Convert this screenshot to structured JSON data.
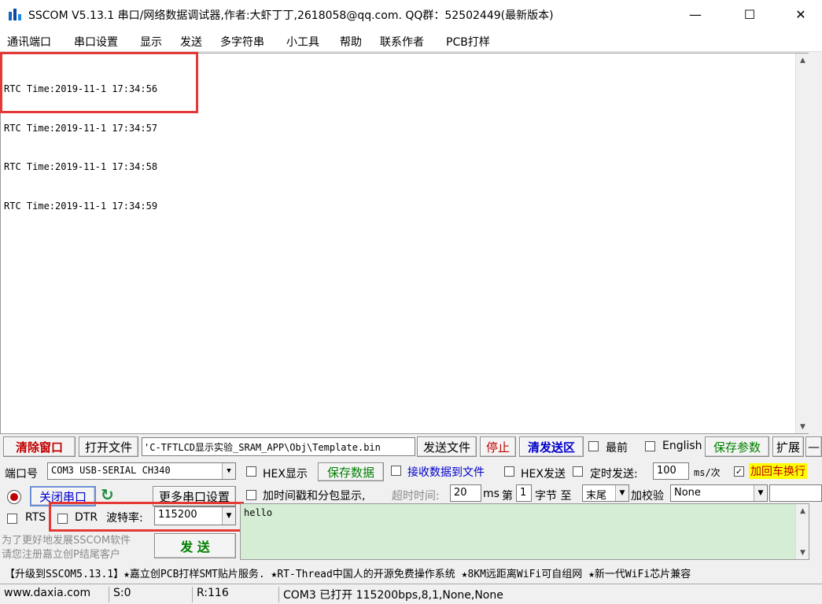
{
  "window": {
    "title": "SSCOM V5.13.1 串口/网络数据调试器,作者:大虾丁丁,2618058@qq.com. QQ群：52502449(最新版本)",
    "minimize": "—",
    "maximize": "☐",
    "close": "✕"
  },
  "menu": [
    "通讯端口",
    "串口设置",
    "显示",
    "发送",
    "多字符串",
    "小工具",
    "帮助",
    "联系作者",
    "PCB打样"
  ],
  "receive": {
    "lines": [
      "RTC Time:2019-11-1 17:34:56",
      "RTC Time:2019-11-1 17:34:57",
      "RTC Time:2019-11-1 17:34:58",
      "RTC Time:2019-11-1 17:34:59"
    ]
  },
  "toolbar": {
    "clear": "清除窗口",
    "open_file": "打开文件",
    "file_path": "'C-TFTLCD显示实验_SRAM_APP\\Obj\\Template.bin",
    "send_file": "发送文件",
    "stop": "停止",
    "clear_send": "清发送区",
    "last": "最前",
    "english": "English",
    "save_params": "保存参数",
    "expand": "扩展",
    "dash": "—"
  },
  "port": {
    "label": "端口号",
    "value": "COM3 USB-SERIAL CH340",
    "close_port": "关闭串口",
    "more_settings": "更多串口设置",
    "rts": "RTS",
    "dtr": "DTR",
    "baud_label": "波特率:",
    "baud_value": "115200"
  },
  "options": {
    "hex_display": "HEX显示",
    "save_data": "保存数据",
    "recv_to_file": "接收数据到文件",
    "hex_send": "HEX发送",
    "timed_send": "定时发送:",
    "interval": "100",
    "interval_unit": "ms/次",
    "add_crlf": "加回车换行",
    "timestamp": "加时间戳和分包显示,",
    "timeout_label": "超时时间:",
    "timeout_value": "20",
    "ms": "ms",
    "nth": "第",
    "byte_index": "1",
    "byte_label": "字节 至",
    "end_value": "末尾",
    "checksum_label": "加校验",
    "checksum_value": "None"
  },
  "promo": {
    "line1": "为了更好地发展SSCOM软件",
    "line2": "请您注册嘉立创P结尾客户"
  },
  "send": {
    "button": "发 送",
    "text": "hello"
  },
  "ticker": "【升级到SSCOM5.13.1】★嘉立创PCB打样SMT贴片服务. ★RT-Thread中国人的开源免费操作系统 ★8KM远距离WiFi可自组网 ★新一代WiFi芯片兼容",
  "status": {
    "site": "www.daxia.com",
    "sent": "S:0",
    "received": "R:116",
    "port_state": "COM3 已打开  115200bps,8,1,None,None"
  },
  "colors": {
    "highlight_box": "#e53935",
    "send_area": "#d4edd4",
    "crlf_highlight": "#ffff00",
    "action_green": "#008000",
    "action_red": "#c00000",
    "action_blue": "#0000cc"
  }
}
